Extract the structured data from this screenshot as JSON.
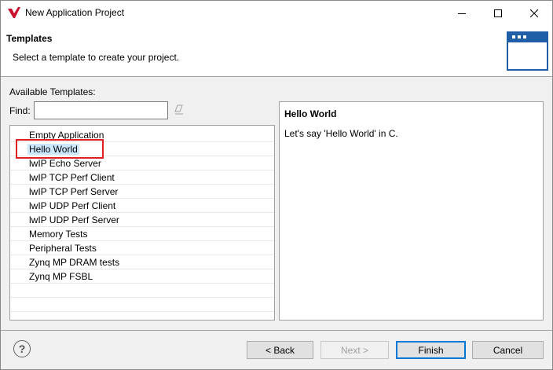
{
  "window": {
    "title": "New Application Project"
  },
  "header": {
    "title": "Templates",
    "description": "Select a template to create your project."
  },
  "templates": {
    "available_label": "Available Templates:",
    "find_label": "Find:",
    "find_value": "",
    "items": [
      {
        "label": "Empty Application",
        "selected": false
      },
      {
        "label": "Hello World",
        "selected": true
      },
      {
        "label": "lwIP Echo Server",
        "selected": false
      },
      {
        "label": "lwIP TCP Perf Client",
        "selected": false
      },
      {
        "label": "lwIP TCP Perf Server",
        "selected": false
      },
      {
        "label": "lwIP UDP Perf Client",
        "selected": false
      },
      {
        "label": "lwIP UDP Perf Server",
        "selected": false
      },
      {
        "label": "Memory Tests",
        "selected": false
      },
      {
        "label": "Peripheral Tests",
        "selected": false
      },
      {
        "label": "Zynq MP DRAM tests",
        "selected": false
      },
      {
        "label": "Zynq MP FSBL",
        "selected": false
      }
    ]
  },
  "description_panel": {
    "title": "Hello World",
    "text": "Let's say 'Hello World' in C."
  },
  "footer": {
    "help_label": "?",
    "back_label": "< Back",
    "next_label": "Next >",
    "finish_label": "Finish",
    "cancel_label": "Cancel"
  },
  "colors": {
    "selection": "#cce8ff",
    "highlight_border": "#e02020",
    "default_button_border": "#0078d7"
  },
  "icons": [
    "app-logo-icon",
    "minimize-icon",
    "maximize-icon",
    "close-icon",
    "wizard-banner-icon",
    "clear-filter-icon",
    "help-icon"
  ]
}
